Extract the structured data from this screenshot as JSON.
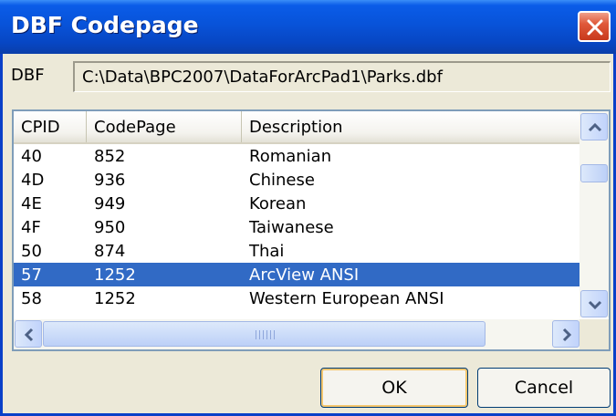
{
  "window": {
    "title": "DBF Codepage"
  },
  "dbf": {
    "label": "DBF",
    "path": "C:\\Data\\BPC2007\\DataForArcPad1\\Parks.dbf"
  },
  "grid": {
    "columns": [
      "CPID",
      "CodePage",
      "Description"
    ],
    "rows": [
      {
        "cpid": "40",
        "codepage": "852",
        "description": "Romanian"
      },
      {
        "cpid": "4D",
        "codepage": "936",
        "description": "Chinese"
      },
      {
        "cpid": "4E",
        "codepage": "949",
        "description": "Korean"
      },
      {
        "cpid": "4F",
        "codepage": "950",
        "description": "Taiwanese"
      },
      {
        "cpid": "50",
        "codepage": "874",
        "description": "Thai"
      },
      {
        "cpid": "57",
        "codepage": "1252",
        "description": "ArcView ANSI"
      },
      {
        "cpid": "58",
        "codepage": "1252",
        "description": "Western European ANSI"
      }
    ],
    "selected_row": 5
  },
  "buttons": {
    "ok": "OK",
    "cancel": "Cancel"
  },
  "colors": {
    "selection": "#316ac5",
    "titlebar": "#0853d9",
    "close": "#e0593a"
  },
  "icons": [
    "close-icon",
    "scroll-up-arrow-icon",
    "scroll-down-arrow-icon",
    "scroll-left-arrow-icon",
    "scroll-right-arrow-icon"
  ]
}
